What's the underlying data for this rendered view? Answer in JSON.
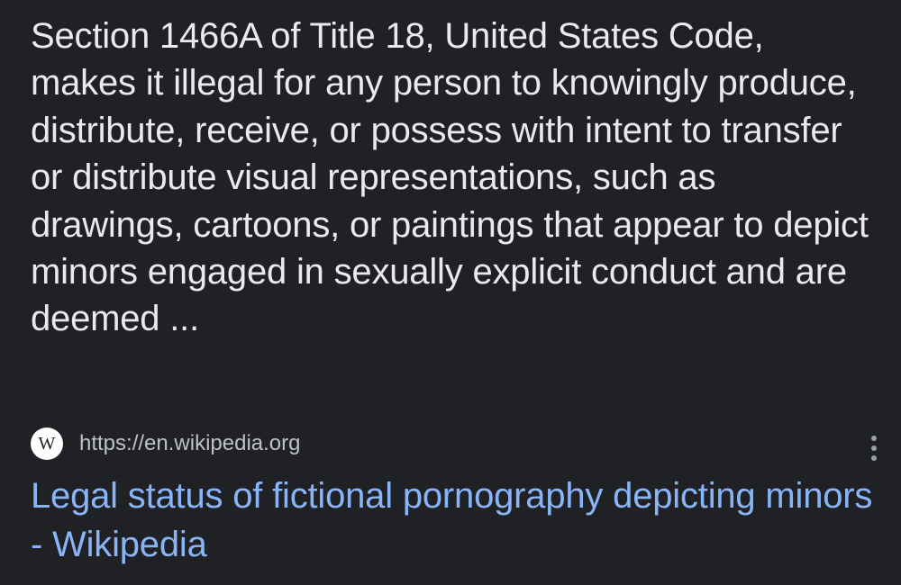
{
  "result": {
    "snippet": "Section 1466A of Title 18, United States Code, makes it illegal for any person to knowingly produce, distribute, receive, or possess with intent to transfer or distribute visual representations, such as drawings, cartoons, or paintings that appear to depict minors engaged in sexually explicit conduct and are deemed ...",
    "source": {
      "favicon_letter": "W",
      "url": "https://en.wikipedia.org"
    },
    "title": "Legal status of fictional pornography depicting minors - Wikipedia"
  },
  "icons": {
    "favicon": "wikipedia-icon",
    "more": "more-vert-icon"
  },
  "colors": {
    "background": "#202124",
    "text": "#e8eaed",
    "url": "#bdc1c6",
    "link": "#8ab4f8"
  }
}
